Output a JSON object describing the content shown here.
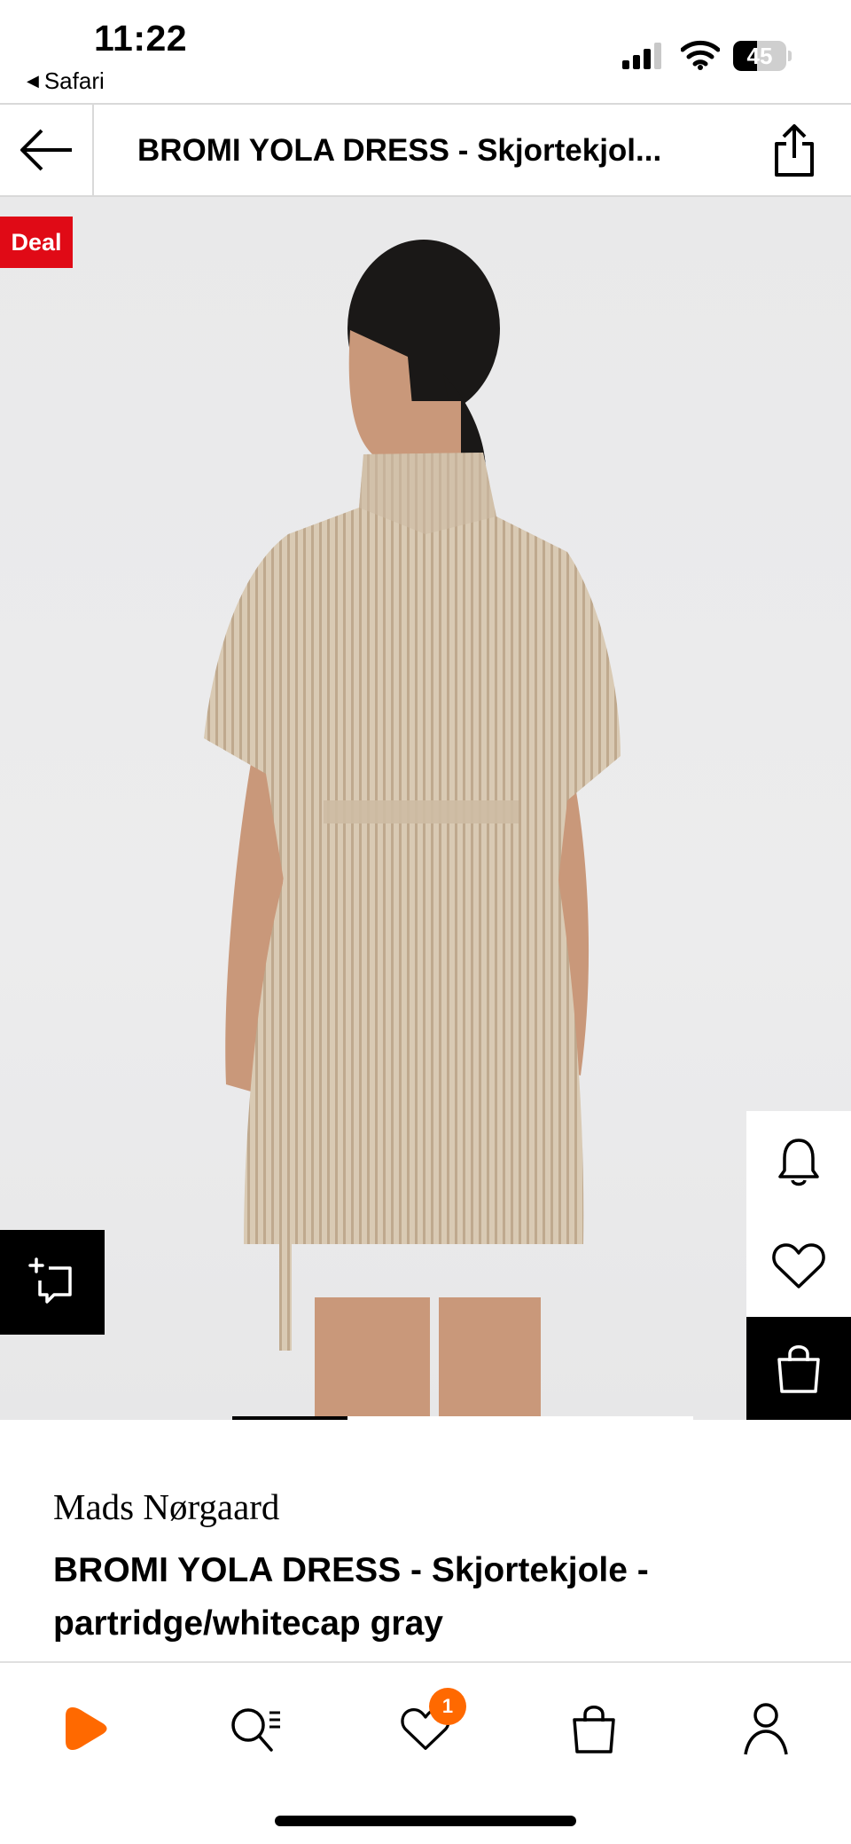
{
  "status_bar": {
    "time": "11:22",
    "back_app": "Safari",
    "battery_level": "45",
    "battery_percent": 45,
    "icons": [
      "signal-icon",
      "wifi-icon",
      "battery-icon"
    ]
  },
  "header": {
    "title": "BROMI YOLA DRESS - Skjortekjol...",
    "back_icon": "arrow-left-icon",
    "share_icon": "share-icon"
  },
  "product_image": {
    "deal_label": "Deal",
    "colors": {
      "deal": "#e00a16",
      "background": "#ebebec",
      "dress": "#d8c8b1"
    },
    "carousel": {
      "active_index": 0,
      "count": 4
    },
    "actions": [
      "compare-icon",
      "bell-icon",
      "heart-icon",
      "bag-icon"
    ]
  },
  "product": {
    "brand": "Mads Nørgaard",
    "name": "BROMI YOLA DRESS - Skjortekjole - partridge/whitecap gray"
  },
  "bottom_nav": {
    "items": [
      {
        "name": "home",
        "icon": "zalando-logo-icon"
      },
      {
        "name": "search",
        "icon": "search-icon"
      },
      {
        "name": "wishlist",
        "icon": "heart-icon",
        "badge": "1"
      },
      {
        "name": "bag",
        "icon": "bag-icon"
      },
      {
        "name": "account",
        "icon": "person-icon"
      }
    ],
    "accent_color": "#ff6900"
  }
}
